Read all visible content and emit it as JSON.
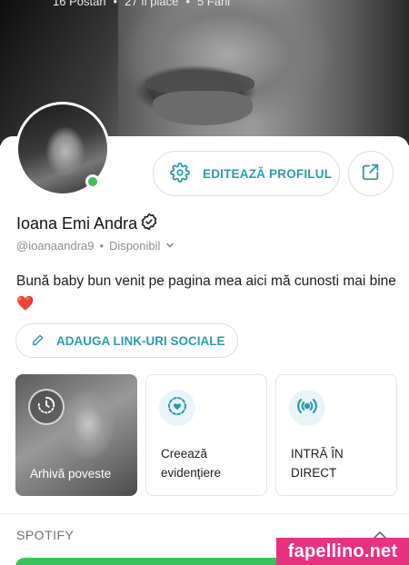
{
  "cover": {
    "stats": [
      "16 Postări",
      "•",
      "27 îi place",
      "•",
      "5 Fani"
    ]
  },
  "profile": {
    "edit_label": "EDITEAZĂ PROFILUL",
    "name": "Ioana Emi Andra",
    "handle": "@ioanaandra9",
    "separator": "•",
    "status": "Disponibil",
    "bio": "Bună baby bun venit pe pagina mea aici mă cunosti mai bine",
    "bio_emoji": "❤️",
    "social_label": "ADAUGA LINK-URI SOCIALE"
  },
  "cards": {
    "archive": "Arhivă poveste",
    "highlight_line1": "Creează",
    "highlight_line2": "evidențiere",
    "live_line1": "INTRĂ ÎN",
    "live_line2": "DIRECT"
  },
  "spotify": {
    "title": "SPOTIFY"
  },
  "watermark": "fapellino.net",
  "colors": {
    "accent": "#2a9bb0",
    "online": "#3fbf5a",
    "spotify": "#39c25e",
    "watermark_bg": "#e8327f"
  }
}
